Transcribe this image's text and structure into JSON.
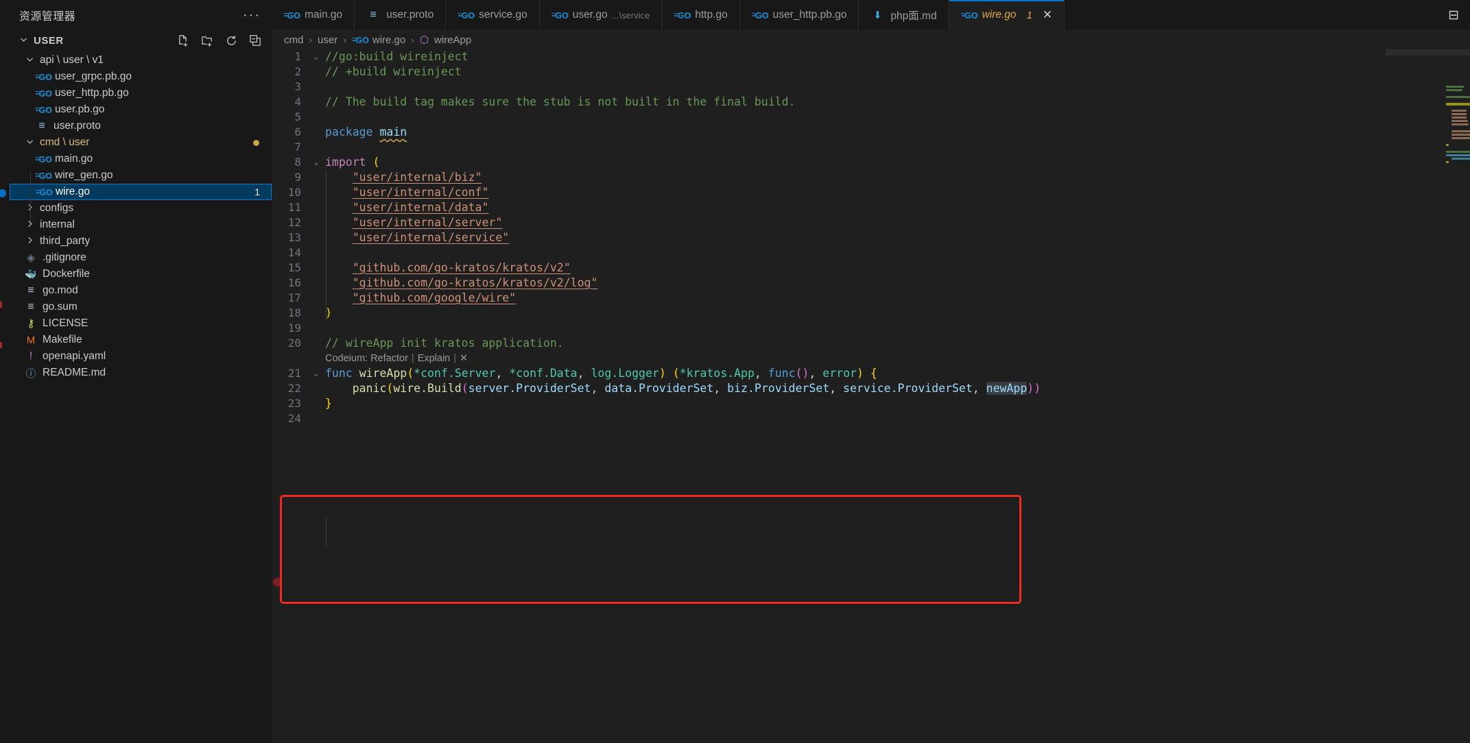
{
  "window": {
    "theme_bg": "#1f1f1f",
    "sidebar_bg": "#181818",
    "accent": "#0078d4",
    "annotation_color": "#ef2a24"
  },
  "sidebar": {
    "title": "资源管理器",
    "more_label": "···",
    "folder_label": "USER",
    "actions": [
      {
        "name": "new-file-icon",
        "tooltip": "新建文件"
      },
      {
        "name": "new-folder-icon",
        "tooltip": "新建文件夹"
      },
      {
        "name": "refresh-icon",
        "tooltip": "刷新资源管理器"
      },
      {
        "name": "collapse-all-icon",
        "tooltip": "在资源管理器中折叠文件夹"
      }
    ],
    "items": [
      {
        "label": "api \\ user \\ v1",
        "kind": "folder-open",
        "depth": 1,
        "icon": "chevron-down-icon"
      },
      {
        "label": "user_grpc.pb.go",
        "kind": "file-go",
        "depth": 2,
        "icon": "go-icon"
      },
      {
        "label": "user_http.pb.go",
        "kind": "file-go",
        "depth": 2,
        "icon": "go-icon"
      },
      {
        "label": "user.pb.go",
        "kind": "file-go",
        "depth": 2,
        "icon": "go-icon"
      },
      {
        "label": "user.proto",
        "kind": "file-proto",
        "depth": 2,
        "icon": "proto-icon"
      },
      {
        "label": "cmd \\ user",
        "kind": "folder-open",
        "depth": 1,
        "icon": "chevron-down-icon",
        "dirty": true,
        "yellow": true
      },
      {
        "label": "main.go",
        "kind": "file-go",
        "depth": 2,
        "icon": "go-icon"
      },
      {
        "label": "wire_gen.go",
        "kind": "file-go",
        "depth": 2,
        "icon": "go-icon"
      },
      {
        "label": "wire.go",
        "kind": "file-go",
        "depth": 2,
        "icon": "go-icon",
        "selected": true,
        "count": "1"
      },
      {
        "label": "configs",
        "kind": "folder-closed",
        "depth": 1,
        "icon": "chevron-right-icon"
      },
      {
        "label": "internal",
        "kind": "folder-closed",
        "depth": 1,
        "icon": "chevron-right-icon"
      },
      {
        "label": "third_party",
        "kind": "folder-closed",
        "depth": 1,
        "icon": "chevron-right-icon"
      },
      {
        "label": ".gitignore",
        "kind": "file-git",
        "depth": 1,
        "icon": "git-icon"
      },
      {
        "label": "Dockerfile",
        "kind": "file-docker",
        "depth": 1,
        "icon": "docker-icon"
      },
      {
        "label": "go.mod",
        "kind": "file-mod",
        "depth": 1,
        "icon": "lines-icon"
      },
      {
        "label": "go.sum",
        "kind": "file-mod",
        "depth": 1,
        "icon": "lines-icon"
      },
      {
        "label": "LICENSE",
        "kind": "file-license",
        "depth": 1,
        "icon": "license-icon"
      },
      {
        "label": "Makefile",
        "kind": "file-make",
        "depth": 1,
        "icon": "makefile-icon"
      },
      {
        "label": "openapi.yaml",
        "kind": "file-yaml",
        "depth": 1,
        "icon": "yaml-icon"
      },
      {
        "label": "README.md",
        "kind": "file-md",
        "depth": 1,
        "icon": "info-icon"
      }
    ]
  },
  "tabs": [
    {
      "label": "main.go",
      "icon": "go-icon",
      "active": false
    },
    {
      "label": "user.proto",
      "icon": "proto-icon",
      "active": false
    },
    {
      "label": "service.go",
      "icon": "go-icon",
      "active": false
    },
    {
      "label": "user.go",
      "sub": "...\\service",
      "icon": "go-icon",
      "active": false
    },
    {
      "label": "http.go",
      "icon": "go-icon",
      "active": false
    },
    {
      "label": "user_http.pb.go",
      "icon": "go-icon",
      "active": false
    },
    {
      "label": "php面.md",
      "icon": "markdown-down-icon",
      "active": false
    },
    {
      "label": "wire.go",
      "icon": "go-icon",
      "active": true,
      "badge": "1",
      "close": "✕"
    }
  ],
  "tabbar_right": {
    "split_editor_label": "⊟",
    "name": "split-editor-icon"
  },
  "breadcrumb": {
    "parts": [
      "cmd",
      "user",
      "wire.go",
      "wireApp"
    ],
    "separator": "›"
  },
  "codelens": {
    "prefix": "Codeium:",
    "refactor": "Refactor",
    "explain": "Explain",
    "close": "✕",
    "bar": "|"
  },
  "code": {
    "lines": [
      {
        "n": "1",
        "fold": "⌄"
      },
      {
        "n": "2"
      },
      {
        "n": "3"
      },
      {
        "n": "4"
      },
      {
        "n": "5"
      },
      {
        "n": "6"
      },
      {
        "n": "7"
      },
      {
        "n": "8",
        "fold": "⌄"
      },
      {
        "n": "9"
      },
      {
        "n": "10"
      },
      {
        "n": "11"
      },
      {
        "n": "12"
      },
      {
        "n": "13"
      },
      {
        "n": "14"
      },
      {
        "n": "15"
      },
      {
        "n": "16"
      },
      {
        "n": "17"
      },
      {
        "n": "18"
      },
      {
        "n": "19"
      },
      {
        "n": "20"
      },
      {
        "n": "21",
        "fold": "⌄"
      },
      {
        "n": "22"
      },
      {
        "n": "23"
      },
      {
        "n": "24"
      }
    ],
    "text": {
      "l1": "//go:build wireinject",
      "l2": "// +build wireinject",
      "l4": "// The build tag makes sure the stub is not built in the final build.",
      "l6_kw": "package",
      "l6_name": "main",
      "l8_kw": "import",
      "l8_paren": "(",
      "l9": "\"user/internal/biz\"",
      "l10": "\"user/internal/conf\"",
      "l11": "\"user/internal/data\"",
      "l12": "\"user/internal/server\"",
      "l13": "\"user/internal/service\"",
      "l15": "\"github.com/go-kratos/kratos/v2\"",
      "l16": "\"github.com/go-kratos/kratos/v2/log\"",
      "l17": "\"github.com/google/wire\"",
      "l18": ")",
      "l20": "// wireApp init kratos application.",
      "l21_kw": "func",
      "l21_fn": "wireApp",
      "l21_a": "(",
      "l21_p1": "*conf.Server",
      "l21_c1": ", ",
      "l21_p2": "*conf.Data",
      "l21_c2": ", ",
      "l21_p3": "log.Logger",
      "l21_b": ")",
      "l21_sp": " ",
      "l21_c": "(",
      "l21_r1": "*kratos.App",
      "l21_c3": ", ",
      "l21_r2kw": "func",
      "l21_r2p": "()",
      "l21_c4": ", ",
      "l21_r3": "error",
      "l21_d": ")",
      "l21_brace": " {",
      "l22_fn": "panic",
      "l22_o1": "(",
      "l22_w": "wire.Build",
      "l22_o2": "(",
      "l22_a1": "server.ProviderSet",
      "l22_a2": "data.ProviderSet",
      "l22_a3": "biz.ProviderSet",
      "l22_a4": "service.ProviderSet",
      "l22_a5": "newApp",
      "l22_comma": ", ",
      "l22_close": "))",
      "l23": "}"
    }
  }
}
